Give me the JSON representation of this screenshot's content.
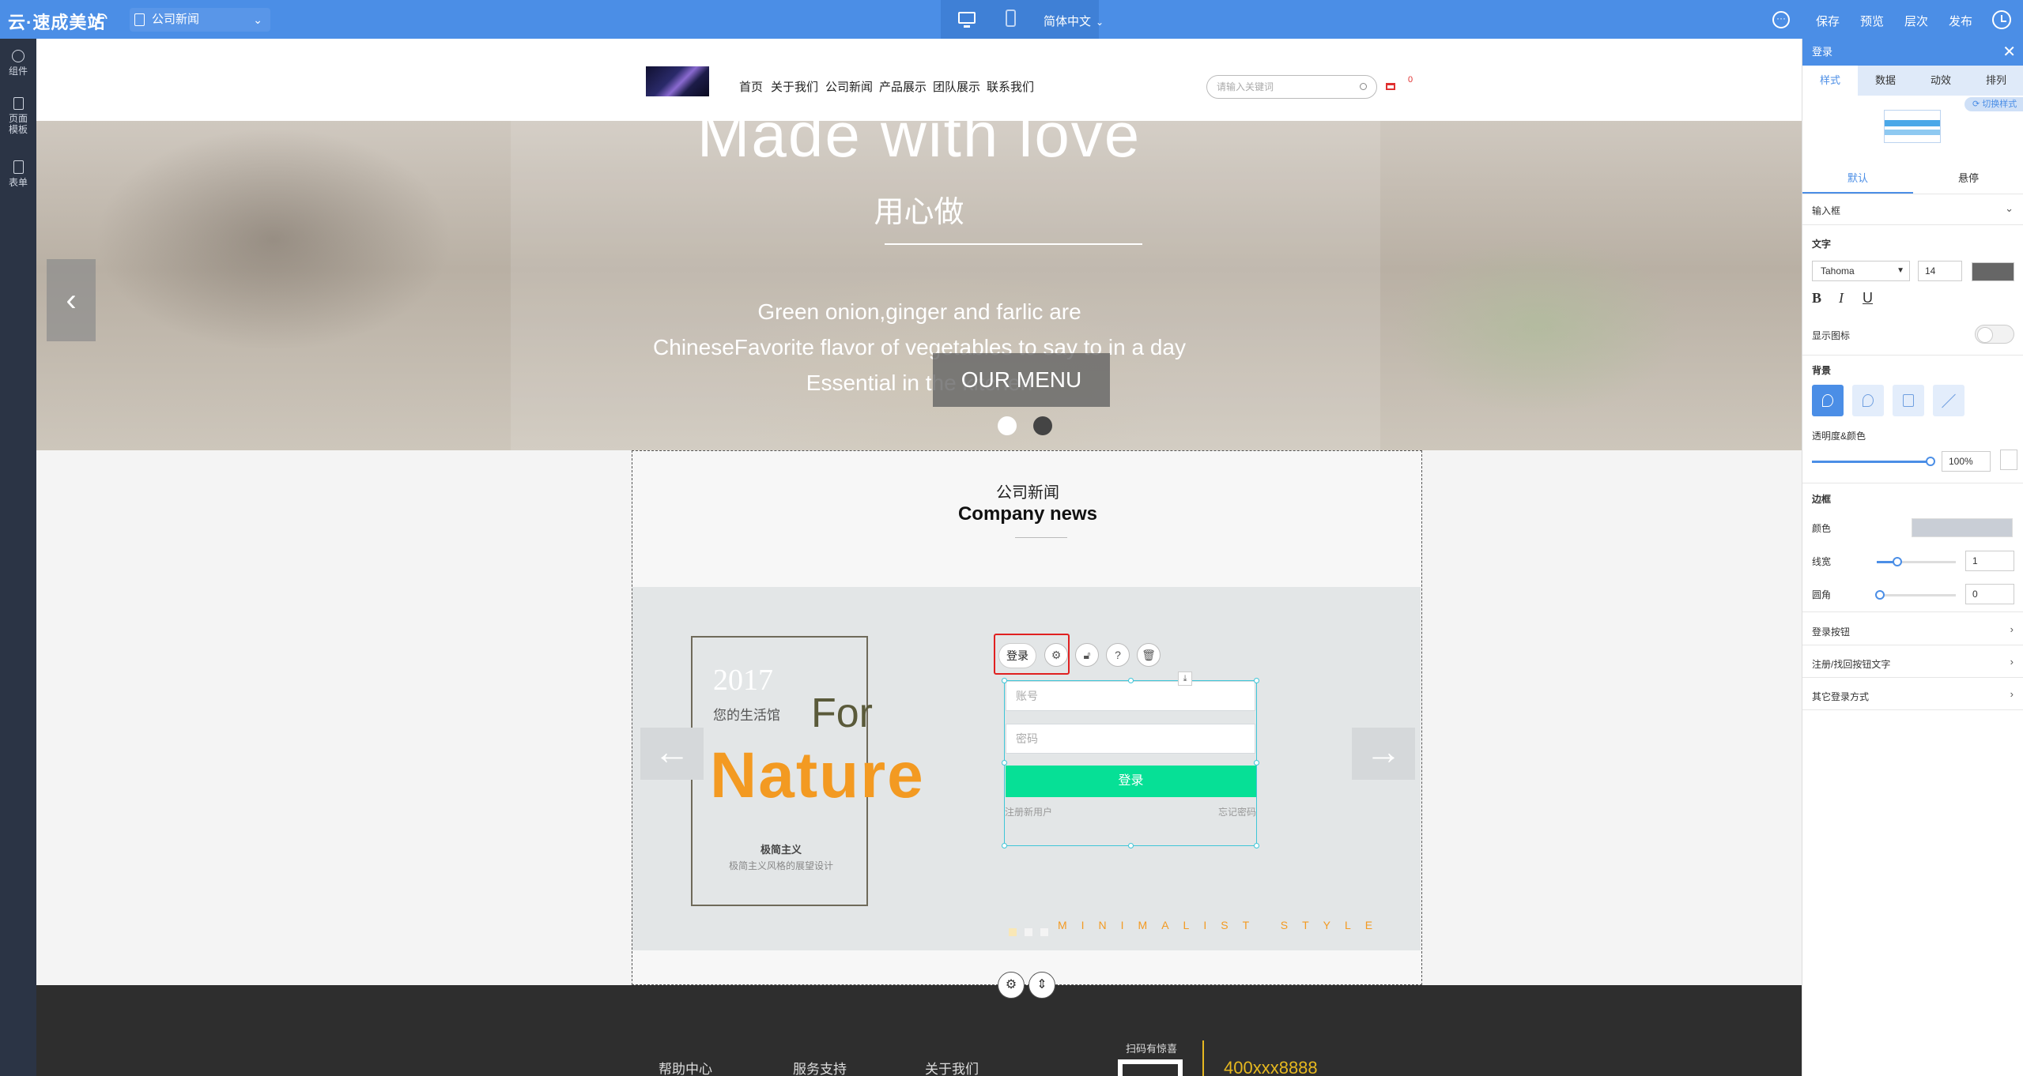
{
  "app": {
    "logo": "云·速成美站",
    "page_selector": "公司新闻",
    "language": "简体中文",
    "actions": [
      "保存",
      "预览",
      "层次",
      "发布"
    ]
  },
  "left_rail": {
    "items": [
      {
        "label": "组件"
      },
      {
        "label": "页面模板"
      },
      {
        "label": "表单"
      }
    ]
  },
  "site": {
    "nav": [
      "首页",
      "关于我们",
      "公司新闻",
      "产品展示",
      "团队展示",
      "联系我们"
    ],
    "search_placeholder": "请输入关键词",
    "cart_count": "0"
  },
  "hero": {
    "title": "Made with love",
    "subtitle": "用心做",
    "lines": [
      "Green onion,ginger and farlic are",
      "ChineseFavorite flavor of vegetables to say to in a day",
      "Essential in the kitchen"
    ],
    "button": "OUR MENU"
  },
  "news": {
    "title_cn": "公司新闻",
    "title_en": "Company news",
    "card": {
      "year": "2017",
      "cn": "您的生活馆",
      "for": "For",
      "nature": "Nature",
      "minimal": "极简主义",
      "minimal_sub": "极简主义风格的展望设计"
    },
    "tagline": "MINIMALIST STYLE"
  },
  "login_widget": {
    "account_placeholder": "账号",
    "password_placeholder": "密码",
    "button": "登录",
    "register": "注册新用户",
    "forgot": "忘记密码",
    "toolbar_label": "登录"
  },
  "footer": {
    "links": [
      "帮助中心",
      "服务支持",
      "关于我们"
    ],
    "scan": "扫码有惊喜",
    "phone": "400xxx8888"
  },
  "panel": {
    "title": "登录",
    "tabs": [
      "样式",
      "数据",
      "动效",
      "排列"
    ],
    "switch_style": "切换样式",
    "subtabs": [
      "默认",
      "悬停"
    ],
    "input_box": "输入框",
    "text_section": "文字",
    "font": "Tahoma",
    "font_size": "14",
    "text_color": "#666666",
    "show_icon": "显示图标",
    "background": "背景",
    "opacity_color": "透明度&颜色",
    "opacity_value": "100%",
    "opacity_fraction": 1.0,
    "border": "边框",
    "border_color_label": "颜色",
    "border_color": "#c9ced6",
    "line_width_label": "线宽",
    "line_width": "1",
    "radius_label": "圆角",
    "radius": "0",
    "sections": [
      "登录按钮",
      "注册/找回按钮文字",
      "其它登录方式"
    ]
  },
  "colors": {
    "accent": "#4b8ee6",
    "login_button": "#06e096",
    "nature_orange": "#f39a22",
    "footer_bg": "#2e2e2e",
    "phone_gold": "#e6b820",
    "selection_red": "#e02020"
  }
}
